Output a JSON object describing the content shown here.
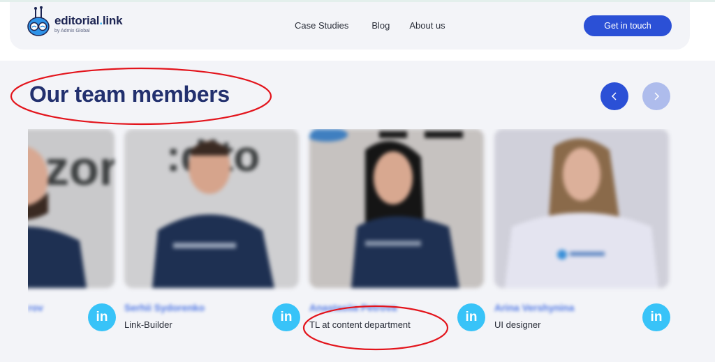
{
  "header": {
    "logo": {
      "title_main": "editorial",
      "title_dot": ".",
      "title_end": "link",
      "subtitle": "by Admix Global"
    },
    "nav": [
      {
        "label": "Case Studies"
      },
      {
        "label": "Blog"
      },
      {
        "label": "About us"
      }
    ],
    "cta_label": "Get in touch"
  },
  "team": {
    "title": "Our team members",
    "prev_icon": "chevron-left-icon",
    "next_icon": "chevron-right-icon",
    "members": [
      {
        "name": "rov",
        "role": "",
        "linkedin": "in"
      },
      {
        "name": "Serhii Sydorenko",
        "role": "Link-Builder",
        "linkedin": "in"
      },
      {
        "name": "Anastasiia Petrova",
        "role": "TL at content department",
        "linkedin": "in"
      },
      {
        "name": "Arina Vershynina",
        "role": "UI designer",
        "linkedin": "in"
      }
    ]
  },
  "colors": {
    "brand_blue": "#2b50d6",
    "heading_navy": "#22306e",
    "linkedin_cyan": "#38c3f8",
    "annotation_red": "#e3141c",
    "section_bg": "#f3f4f8"
  }
}
